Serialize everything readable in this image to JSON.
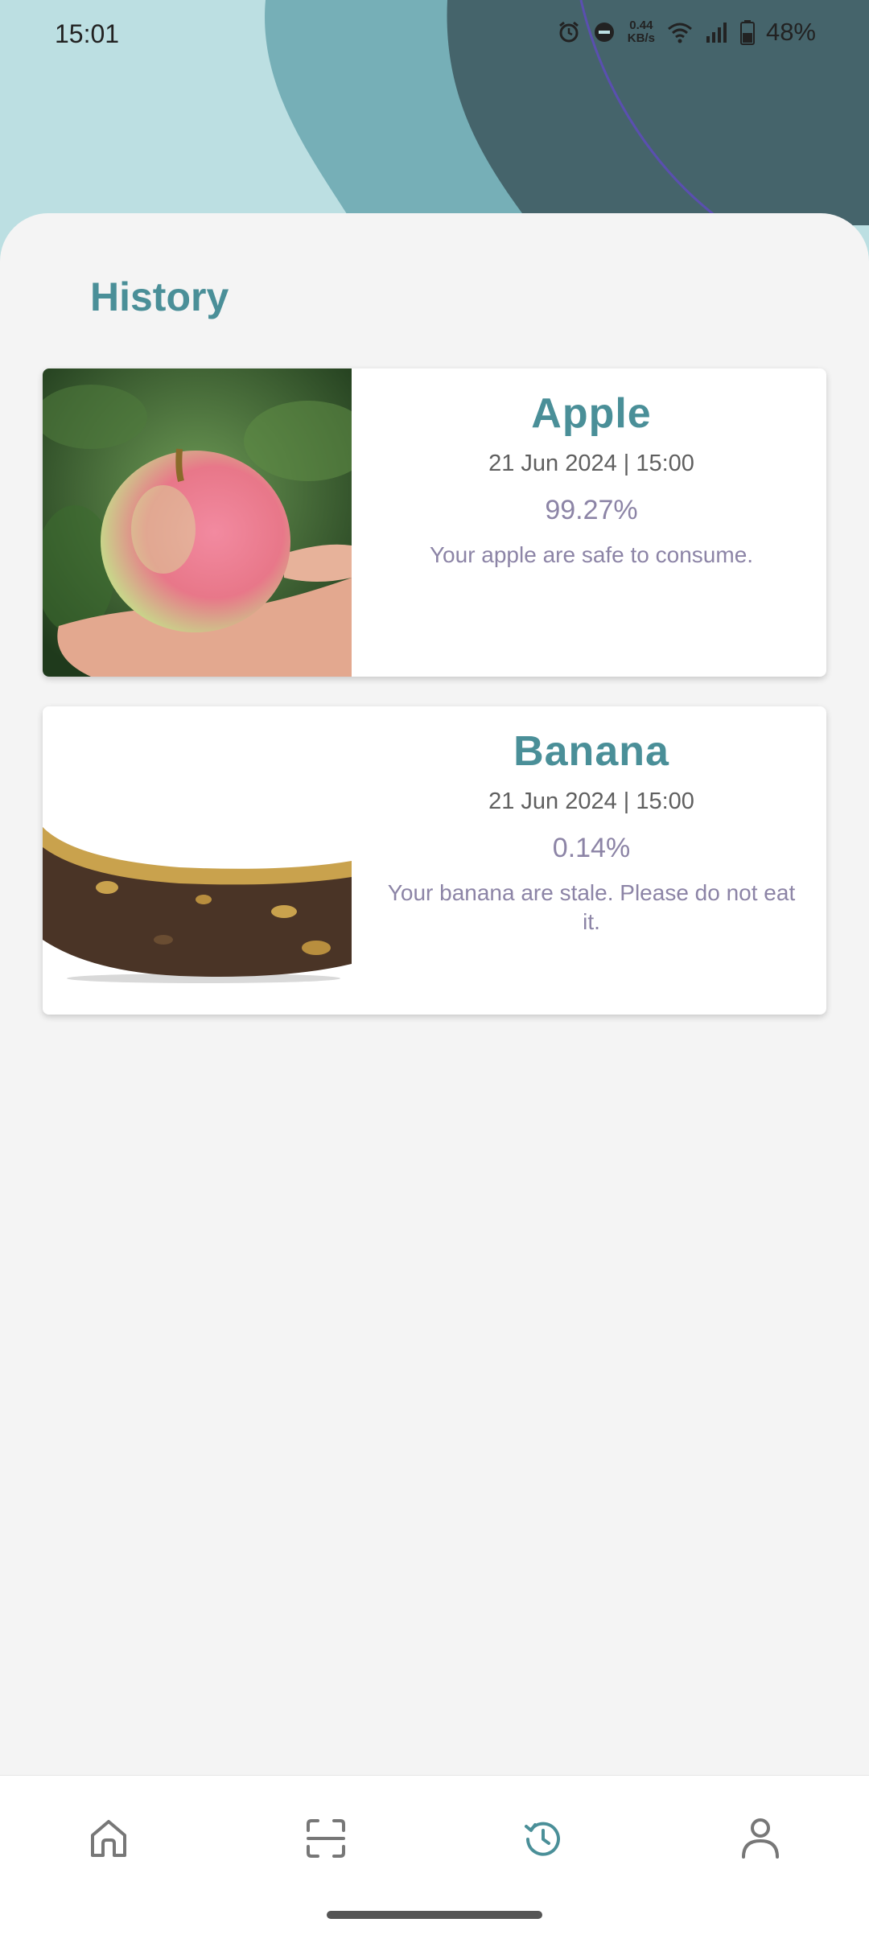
{
  "status_bar": {
    "time": "15:01",
    "net_speed_value": "0.44",
    "net_speed_unit": "KB/s",
    "battery": "48%",
    "icons": [
      "alarm-icon",
      "dnd-icon",
      "wifi-icon",
      "signal-icon",
      "battery-icon"
    ]
  },
  "page": {
    "title": "History"
  },
  "history": [
    {
      "name": "Apple",
      "datetime": "21 Jun 2024 | 15:00",
      "percent": "99.27%",
      "message": "Your apple are safe to consume."
    },
    {
      "name": "Banana",
      "datetime": "21 Jun 2024 | 15:00",
      "percent": "0.14%",
      "message": "Your banana are stale. Please do not eat it."
    }
  ],
  "nav": {
    "items": [
      "home-icon",
      "scan-icon",
      "history-icon",
      "profile-icon"
    ],
    "active": "history-icon",
    "active_color": "#4a8f98",
    "inactive_color": "#777777"
  },
  "colors": {
    "accent": "#4a8f98",
    "secondary_text": "#8c84a6",
    "background": "#f4f4f4"
  }
}
